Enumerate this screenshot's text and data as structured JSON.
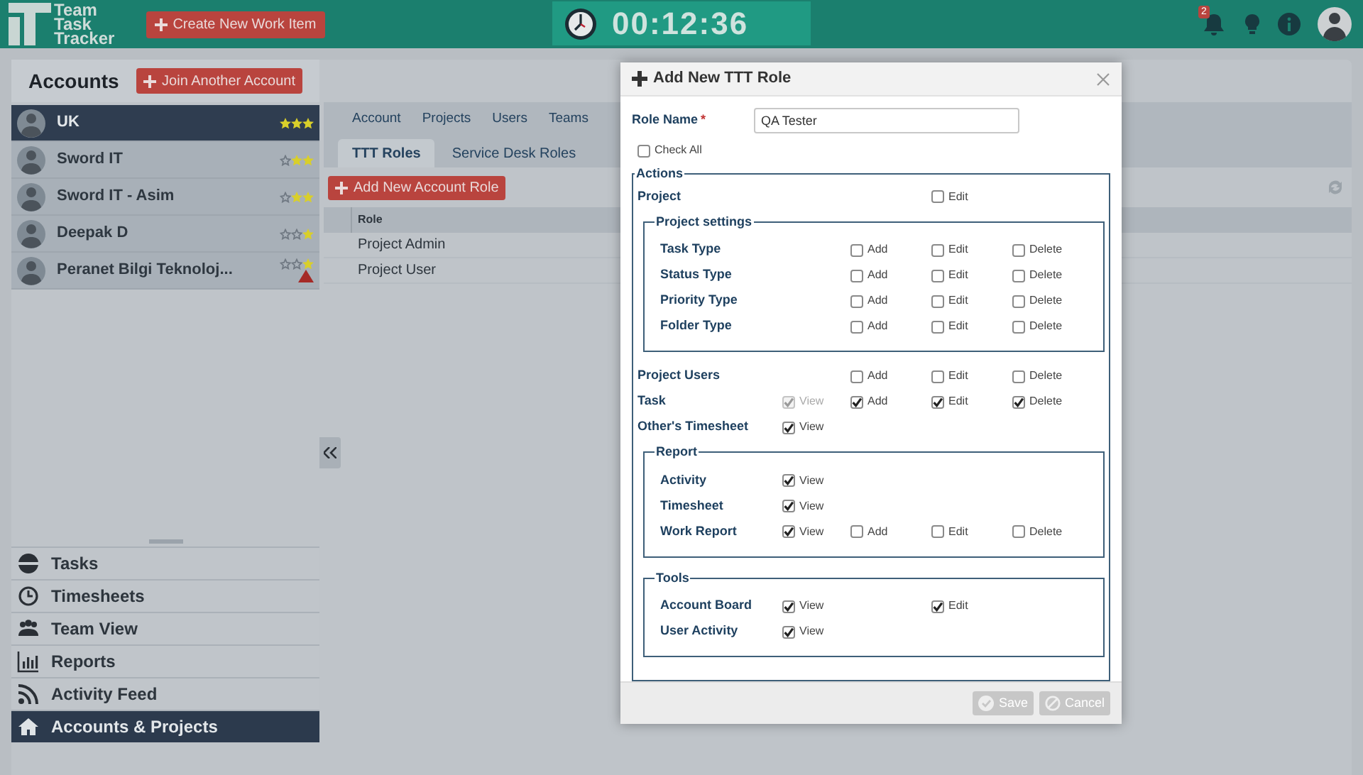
{
  "header": {
    "logo": [
      "Team",
      "Task",
      "Tracker"
    ],
    "create_button": "Create New Work Item",
    "timer": "00:12:36",
    "notification_count": "2"
  },
  "accounts_panel": {
    "title": "Accounts",
    "join_button": "Join Another Account",
    "accounts": [
      {
        "name": "UK",
        "stars": 3,
        "selected": true,
        "warning": false
      },
      {
        "name": "Sword IT",
        "stars": 2,
        "selected": false,
        "warning": false
      },
      {
        "name": "Sword IT - Asim",
        "stars": 2,
        "selected": false,
        "warning": false
      },
      {
        "name": "Deepak D",
        "stars": 1,
        "selected": false,
        "warning": false
      },
      {
        "name": "Peranet Bilgi Teknoloj...",
        "stars": 1,
        "selected": false,
        "warning": true
      }
    ]
  },
  "nav": [
    {
      "label": "Tasks",
      "selected": false
    },
    {
      "label": "Timesheets",
      "selected": false
    },
    {
      "label": "Team View",
      "selected": false
    },
    {
      "label": "Reports",
      "selected": false
    },
    {
      "label": "Activity Feed",
      "selected": false
    },
    {
      "label": "Accounts & Projects",
      "selected": true
    }
  ],
  "tabs": [
    {
      "label": "Account",
      "selected": false
    },
    {
      "label": "Projects",
      "selected": false
    },
    {
      "label": "Users",
      "selected": false
    },
    {
      "label": "Teams",
      "selected": false
    }
  ],
  "subtabs": [
    {
      "label": "TTT Roles",
      "selected": true
    },
    {
      "label": "Service Desk Roles",
      "selected": false
    }
  ],
  "add_role_button": "Add New Account Role",
  "roles_table": {
    "columns": [
      "Role"
    ],
    "rows": [
      "Project Admin",
      "Project User"
    ]
  },
  "dialog": {
    "title": "Add New TTT Role",
    "role_name_label": "Role Name",
    "required_mark": "*",
    "role_name_value": "QA Tester",
    "check_all": {
      "label": "Check All",
      "checked": false
    },
    "actions": {
      "legend": "Actions",
      "items": [
        {
          "kind": "row",
          "label": "Project",
          "perms": [
            {
              "kind": "edit",
              "label": "Edit",
              "checked": false,
              "disabled": false
            }
          ]
        },
        {
          "kind": "group",
          "legend": "Project settings",
          "rows": [
            {
              "label": "Task Type",
              "perms": [
                {
                  "kind": "add",
                  "label": "Add",
                  "checked": false,
                  "disabled": false
                },
                {
                  "kind": "edit",
                  "label": "Edit",
                  "checked": false,
                  "disabled": false
                },
                {
                  "kind": "delete",
                  "label": "Delete",
                  "checked": false,
                  "disabled": false
                }
              ]
            },
            {
              "label": "Status Type",
              "perms": [
                {
                  "kind": "add",
                  "label": "Add",
                  "checked": false,
                  "disabled": false
                },
                {
                  "kind": "edit",
                  "label": "Edit",
                  "checked": false,
                  "disabled": false
                },
                {
                  "kind": "delete",
                  "label": "Delete",
                  "checked": false,
                  "disabled": false
                }
              ]
            },
            {
              "label": "Priority Type",
              "perms": [
                {
                  "kind": "add",
                  "label": "Add",
                  "checked": false,
                  "disabled": false
                },
                {
                  "kind": "edit",
                  "label": "Edit",
                  "checked": false,
                  "disabled": false
                },
                {
                  "kind": "delete",
                  "label": "Delete",
                  "checked": false,
                  "disabled": false
                }
              ]
            },
            {
              "label": "Folder Type",
              "perms": [
                {
                  "kind": "add",
                  "label": "Add",
                  "checked": false,
                  "disabled": false
                },
                {
                  "kind": "edit",
                  "label": "Edit",
                  "checked": false,
                  "disabled": false
                },
                {
                  "kind": "delete",
                  "label": "Delete",
                  "checked": false,
                  "disabled": false
                }
              ]
            }
          ]
        },
        {
          "kind": "row",
          "label": "Project Users",
          "perms": [
            {
              "kind": "add",
              "label": "Add",
              "checked": false,
              "disabled": false
            },
            {
              "kind": "edit",
              "label": "Edit",
              "checked": false,
              "disabled": false
            },
            {
              "kind": "delete",
              "label": "Delete",
              "checked": false,
              "disabled": false
            }
          ]
        },
        {
          "kind": "row",
          "label": "Task",
          "perms": [
            {
              "kind": "view",
              "label": "View",
              "checked": true,
              "disabled": true
            },
            {
              "kind": "add",
              "label": "Add",
              "checked": true,
              "disabled": false
            },
            {
              "kind": "edit",
              "label": "Edit",
              "checked": true,
              "disabled": false
            },
            {
              "kind": "delete",
              "label": "Delete",
              "checked": true,
              "disabled": false
            }
          ]
        },
        {
          "kind": "row",
          "label": "Other's Timesheet",
          "perms": [
            {
              "kind": "view",
              "label": "View",
              "checked": true,
              "disabled": false
            }
          ]
        },
        {
          "kind": "group",
          "legend": "Report",
          "rows": [
            {
              "label": "Activity",
              "perms": [
                {
                  "kind": "view",
                  "label": "View",
                  "checked": true,
                  "disabled": false
                }
              ]
            },
            {
              "label": "Timesheet",
              "perms": [
                {
                  "kind": "view",
                  "label": "View",
                  "checked": true,
                  "disabled": false
                }
              ]
            },
            {
              "label": "Work Report",
              "perms": [
                {
                  "kind": "view",
                  "label": "View",
                  "checked": true,
                  "disabled": false
                },
                {
                  "kind": "add",
                  "label": "Add",
                  "checked": false,
                  "disabled": false
                },
                {
                  "kind": "edit",
                  "label": "Edit",
                  "checked": false,
                  "disabled": false
                },
                {
                  "kind": "delete",
                  "label": "Delete",
                  "checked": false,
                  "disabled": false
                }
              ]
            }
          ]
        },
        {
          "kind": "group",
          "legend": "Tools",
          "rows": [
            {
              "label": "Account Board",
              "perms": [
                {
                  "kind": "view",
                  "label": "View",
                  "checked": true,
                  "disabled": false
                },
                {
                  "kind": "edit",
                  "label": "Edit",
                  "checked": true,
                  "disabled": false
                }
              ]
            },
            {
              "label": "User Activity",
              "perms": [
                {
                  "kind": "view",
                  "label": "View",
                  "checked": true,
                  "disabled": false
                }
              ]
            }
          ]
        }
      ]
    },
    "buttons": [
      {
        "kind": "save",
        "label": "Save"
      },
      {
        "kind": "cancel",
        "label": "Cancel"
      }
    ]
  }
}
